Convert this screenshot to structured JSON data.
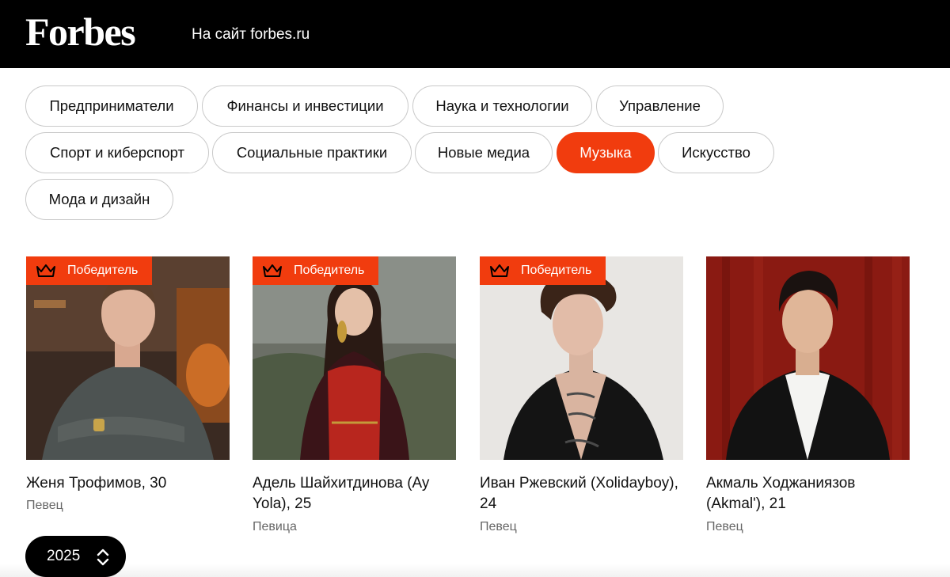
{
  "header": {
    "logo": "Forbes",
    "site_link": "На сайт forbes.ru"
  },
  "categories": [
    {
      "label": "Предприниматели",
      "active": false
    },
    {
      "label": "Финансы и инвестиции",
      "active": false
    },
    {
      "label": "Наука и технологии",
      "active": false
    },
    {
      "label": "Управление",
      "active": false
    },
    {
      "label": "Спорт и киберспорт",
      "active": false
    },
    {
      "label": "Социальные практики",
      "active": false
    },
    {
      "label": "Новые медиа",
      "active": false
    },
    {
      "label": "Музыка",
      "active": true
    },
    {
      "label": "Искусство",
      "active": false
    },
    {
      "label": "Мода и дизайн",
      "active": false
    }
  ],
  "cards": [
    {
      "badge": "Победитель",
      "name": "Женя Трофимов, 30",
      "role": "Певец"
    },
    {
      "badge": "Победитель",
      "name": "Адель Шайхитдинова (Ay Yola), 25",
      "role": "Певица"
    },
    {
      "badge": "Победитель",
      "name": "Иван Ржевский (Xolidayboy), 24",
      "role": "Певец"
    },
    {
      "badge": "",
      "name": "Акмаль Ходжаниязов (Akmal'), 21",
      "role": "Певец"
    }
  ],
  "year_selector": {
    "value": "2025",
    "icon": "chevron-up-down-icon"
  },
  "colors": {
    "accent": "#f13c0e",
    "header_bg": "#000000"
  }
}
